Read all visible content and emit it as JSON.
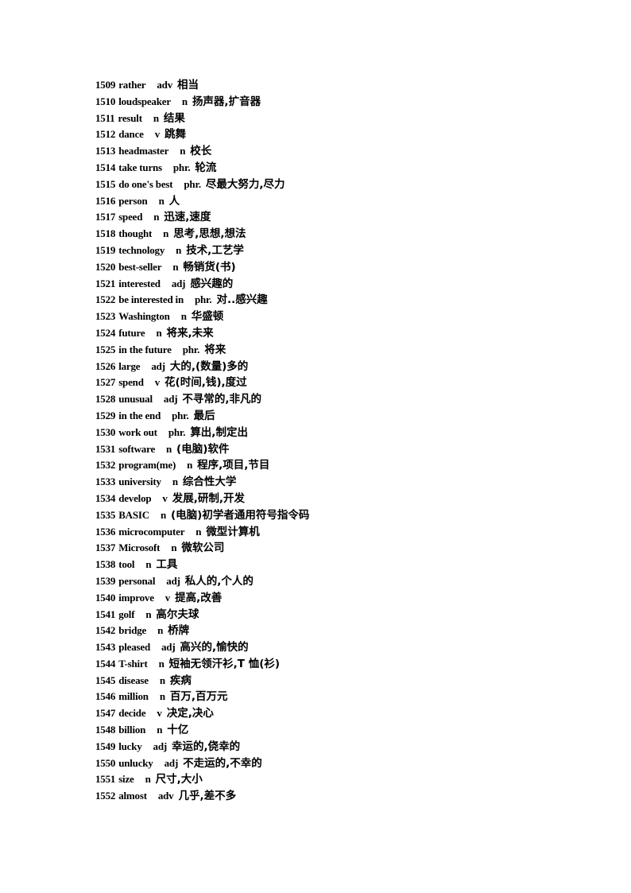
{
  "entries": [
    {
      "num": "1509",
      "word": "rather",
      "pos": "adv",
      "def": "相当"
    },
    {
      "num": "1510",
      "word": "loudspeaker",
      "pos": "n",
      "def": "扬声器,扩音器"
    },
    {
      "num": "1511",
      "word": "result",
      "pos": "n",
      "def": "结果"
    },
    {
      "num": "1512",
      "word": "dance",
      "pos": "v",
      "def": "跳舞"
    },
    {
      "num": "1513",
      "word": "headmaster",
      "pos": "n",
      "def": "校长"
    },
    {
      "num": "1514",
      "word": "take turns",
      "pos": "phr.",
      "def": "轮流"
    },
    {
      "num": "1515",
      "word": "do one's best",
      "pos": "phr.",
      "def": "尽最大努力,尽力"
    },
    {
      "num": "1516",
      "word": "person",
      "pos": "n",
      "def": "人"
    },
    {
      "num": "1517",
      "word": "speed",
      "pos": "n",
      "def": "迅速,速度"
    },
    {
      "num": "1518",
      "word": "thought",
      "pos": "n",
      "def": "思考,思想,想法"
    },
    {
      "num": "1519",
      "word": "technology",
      "pos": "n",
      "def": "技术,工艺学"
    },
    {
      "num": "1520",
      "word": "best-seller",
      "pos": "n",
      "def": "畅销货(书)"
    },
    {
      "num": "1521",
      "word": "interested",
      "pos": "adj",
      "def": "感兴趣的"
    },
    {
      "num": "1522",
      "word": "be interested in",
      "pos": "phr.",
      "def": "对..感兴趣"
    },
    {
      "num": "1523",
      "word": "Washington",
      "pos": "n",
      "def": "华盛顿"
    },
    {
      "num": "1524",
      "word": "future",
      "pos": "n",
      "def": "将来,未来"
    },
    {
      "num": "1525",
      "word": "in the future",
      "pos": "phr.",
      "def": "将来"
    },
    {
      "num": "1526",
      "word": "large",
      "pos": "adj",
      "def": "大的,(数量)多的"
    },
    {
      "num": "1527",
      "word": "spend",
      "pos": "v",
      "def": "花(时间,钱),度过"
    },
    {
      "num": "1528",
      "word": "unusual",
      "pos": "adj",
      "def": "不寻常的,非凡的"
    },
    {
      "num": "1529",
      "word": "in the end",
      "pos": "phr.",
      "def": "最后"
    },
    {
      "num": "1530",
      "word": "work out",
      "pos": "phr.",
      "def": "算出,制定出"
    },
    {
      "num": "1531",
      "word": "software",
      "pos": "n",
      "def": "(电脑)软件"
    },
    {
      "num": "1532",
      "word": "program(me)",
      "pos": "n",
      "def": "程序,项目,节目"
    },
    {
      "num": "1533",
      "word": "university",
      "pos": "n",
      "def": "综合性大学"
    },
    {
      "num": "1534",
      "word": "develop",
      "pos": "v",
      "def": "发展,研制,开发"
    },
    {
      "num": "1535",
      "word": "BASIC",
      "pos": "n",
      "def": "(电脑)初学者通用符号指令码"
    },
    {
      "num": "1536",
      "word": "microcomputer",
      "pos": "n",
      "def": "微型计算机"
    },
    {
      "num": "1537",
      "word": "Microsoft",
      "pos": "n",
      "def": "微软公司"
    },
    {
      "num": "1538",
      "word": "tool",
      "pos": "n",
      "def": "工具"
    },
    {
      "num": "1539",
      "word": "personal",
      "pos": "adj",
      "def": "私人的,个人的"
    },
    {
      "num": "1540",
      "word": "improve",
      "pos": "v",
      "def": "提高,改善"
    },
    {
      "num": "1541",
      "word": "golf",
      "pos": "n",
      "def": "高尔夫球"
    },
    {
      "num": "1542",
      "word": "bridge",
      "pos": "n",
      "def": "桥牌"
    },
    {
      "num": "1543",
      "word": "pleased",
      "pos": "adj",
      "def": "高兴的,愉快的"
    },
    {
      "num": "1544",
      "word": "T-shirt",
      "pos": "n",
      "def": "短袖无领汗衫,T 恤(衫)"
    },
    {
      "num": "1545",
      "word": "disease",
      "pos": "n",
      "def": "疾病"
    },
    {
      "num": "1546",
      "word": "million",
      "pos": "n",
      "def": "百万,百万元"
    },
    {
      "num": "1547",
      "word": "decide",
      "pos": "v",
      "def": "决定,决心"
    },
    {
      "num": "1548",
      "word": "billion",
      "pos": "n",
      "def": "十亿"
    },
    {
      "num": "1549",
      "word": "lucky",
      "pos": "adj",
      "def": "幸运的,侥幸的"
    },
    {
      "num": "1550",
      "word": "unlucky",
      "pos": "adj",
      "def": "不走运的,不幸的"
    },
    {
      "num": "1551",
      "word": "size",
      "pos": "n",
      "def": "尺寸,大小"
    },
    {
      "num": "1552",
      "word": "almost",
      "pos": "adv",
      "def": "几乎,差不多"
    }
  ]
}
